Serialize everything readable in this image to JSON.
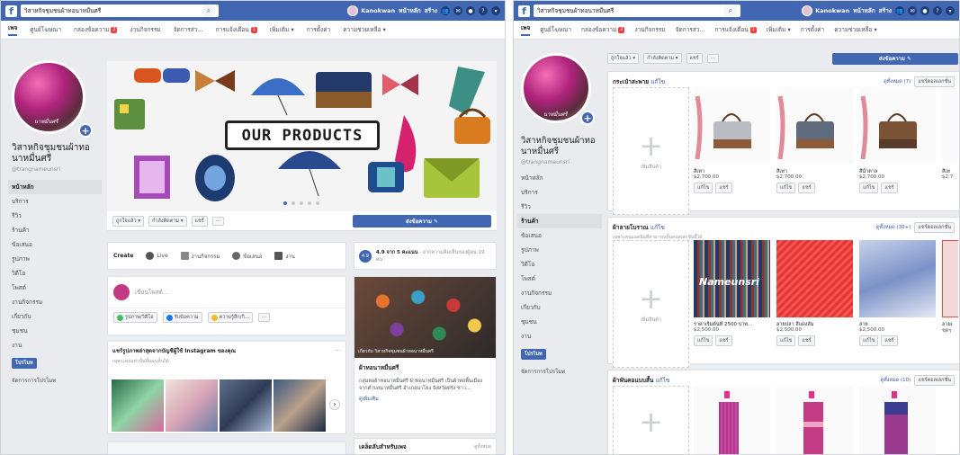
{
  "topbar": {
    "page_name": "วิสาหกิจชุมชนผ้าทอนาหมื่นศรี",
    "user": "Kanokwan",
    "home": "หน้าหลัก",
    "create": "สร้าง"
  },
  "tabs": [
    "เพจ",
    "ศูนย์โฆษณา",
    "กล่องข้อความ",
    "งานกิจกรรม",
    "จัดการส่ว...",
    "การแจ้งเตือน",
    "เพิ่มเติม ▾",
    "การตั้งค่า",
    "ความช่วยเหลือ ▾"
  ],
  "tab_badges": {
    "inbox": "2",
    "notif": "1"
  },
  "profile": {
    "name": "วิสาหกิจชุมชนผ้าทอนาหมื่นศรี",
    "handle": "@trangnameunsri",
    "avatar_text": "นาหมื่นศรี"
  },
  "sidenav": [
    "หน้าหลัก",
    "บริการ",
    "รีวิว",
    "ร้านค้า",
    "ข้อเสนอ",
    "รูปภาพ",
    "วิดีโอ",
    "โพสต์",
    "งานกิจกรรม",
    "เกี่ยวกับ",
    "ชุมชน",
    "งาน"
  ],
  "sidenav2": [
    "หน้าหลัก",
    "บริการ",
    "รีวิว",
    "ร้านค้า",
    "ข้อเสนอ",
    "รูปภาพ",
    "วิดีโอ",
    "โพสต์",
    "งานกิจกรรม",
    "เกี่ยวกับ",
    "ชุมชน",
    "งาน"
  ],
  "promote": "โปรโมท",
  "ad_center": "จัดการการโปรโมท",
  "cover": {
    "banner": "OUR PRODUCTS"
  },
  "action_bar": {
    "like": "ถูกใจแล้ว ▾",
    "follow": "กำลังติดตาม ▾",
    "share": "แชร์",
    "more": "···",
    "send": "ส่งข้อความ ✎"
  },
  "create_bar": {
    "create": "Create",
    "live": "Live",
    "event": "งานกิจกรรม",
    "offer": "ข้อเสนอ",
    "job": "งาน"
  },
  "rating": {
    "score": "4.9",
    "text": "4.9 จาก 5 คะแนน",
    "sub": "· จากความคิดเห็นของผู้คน 19 คน",
    "badge": "4.9"
  },
  "composer": {
    "placeholder": "เขียนโพสต์...",
    "photo": "รูปภาพ/วิดีโอ",
    "msg": "รับข้อความ",
    "feel": "ความรู้สึก/กิ...",
    "more": "···"
  },
  "instagram": {
    "title": "แชร์รูปภาพล่าสุดจากบัญชีผู้ใช้ Instagram ของคุณ",
    "sub": "เฉพาะคุณเท่านั้นที่มองเห็นได้",
    "more": "···",
    "next": "›"
  },
  "about_card": {
    "caption": "เกี่ยวกับ วิสาหกิจชุมชนผ้าทอนาหมื่นศรี",
    "title": "ผ้าทอนาหมื่นศรี",
    "desc": "กลุ่มทอผ้าทอนาหมื่นศรี ผ้าทอนาหมื่นศรี เป็นผ้าทอพื้นเมือง จากตำบลนาหมื่นศรี อำเภอนาโยง จังหวัดตรัง ชาว...",
    "more": "ดูเพิ่มเติม"
  },
  "tips": {
    "title": "เคล็ดลับสำหรับเพจ",
    "more": "ดูทั้งหมด"
  },
  "shop": {
    "action_like": "ถูกใจแล้ว ▾",
    "action_follow": "กำลังติดตาม ▾",
    "action_share": "แชร์",
    "action_more": "···",
    "send": "ส่งข้อความ ✎",
    "add_label": "เพิ่มสินค้า",
    "edit": "แก้ไข",
    "share": "แชร์",
    "sections": [
      {
        "title": "กระเป๋าสะพาย",
        "edit": "แก้ไข",
        "see_all": "ดูทั้งหมด (7)",
        "share": "แชร์คอลเลกชั่น",
        "items": [
          {
            "name": "สีเทา",
            "price": "$2,700.00"
          },
          {
            "name": "สีเทา",
            "price": "$2,700.00"
          },
          {
            "name": "สีน้ำตาล",
            "price": "$2,700.00"
          },
          {
            "name": "สีเท",
            "price": "$2,7"
          }
        ]
      },
      {
        "title": "ผ้าลายโบราณ",
        "edit": "แก้ไข",
        "see_all": "ดูทั้งหมด (30+)",
        "share": "แชร์คอลเลกชั่น",
        "note": "เฉพาะคนแอดมินที่สามารถเห็นคอลเลกชันนี้ได้",
        "items": [
          {
            "name": "ราคาเริ่มต้นที่ 2500 บาท...",
            "price": "$2,500.00"
          },
          {
            "name": "ลายปลา สีแดงส้ม",
            "price": "$2,500.00"
          },
          {
            "name": "ลาย",
            "price": "$2,500.00"
          },
          {
            "name": "ลายเ",
            "price": "ชุดๆ"
          }
        ]
      },
      {
        "title": "ผ้าพันคอแบบสั้น",
        "edit": "แก้ไข",
        "see_all": "ดูทั้งหมด (10)",
        "share": "แชร์คอลเลกชั่น"
      }
    ],
    "fabric_brand": "Nameunsri"
  },
  "colors": {
    "fb_blue": "#4267b2",
    "bg": "#e9ebee",
    "badge_red": "#fa3e3e"
  }
}
